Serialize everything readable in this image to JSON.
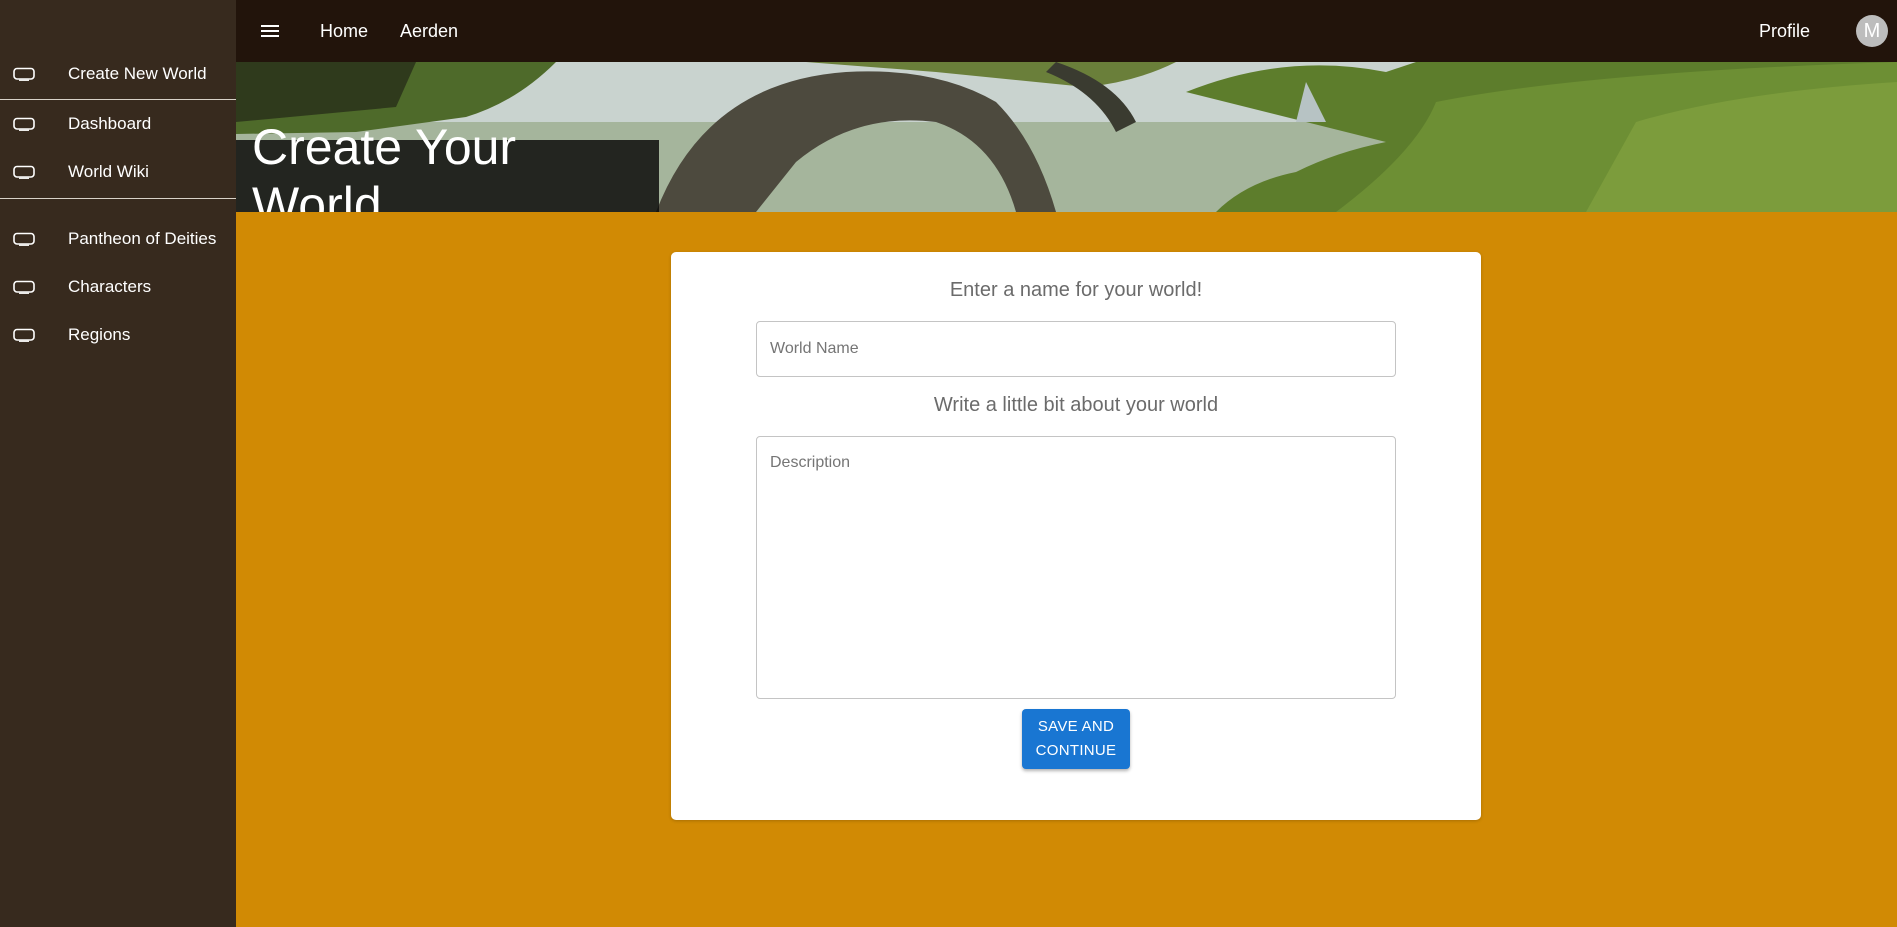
{
  "sidebar": {
    "items": [
      {
        "label": "Create New World",
        "icon": "tv-icon"
      },
      {
        "label": "Dashboard",
        "icon": "tv-icon"
      },
      {
        "label": "World Wiki",
        "icon": "tv-icon"
      },
      {
        "label": "Pantheon of Deities",
        "icon": "tv-icon"
      },
      {
        "label": "Characters",
        "icon": "tv-icon"
      },
      {
        "label": "Regions",
        "icon": "tv-icon"
      }
    ]
  },
  "topbar": {
    "menu_icon": "hamburger-menu-icon",
    "nav": [
      "Home",
      "Aerden"
    ],
    "profile_label": "Profile",
    "avatar_initial": "M"
  },
  "banner": {
    "title": "Create Your World"
  },
  "form": {
    "name_prompt": "Enter a name for your world!",
    "name_placeholder": "World Name",
    "name_value": "",
    "description_prompt": "Write a little bit about your world",
    "description_placeholder": "Description",
    "description_value": "",
    "save_label": "SAVE AND CONTINUE"
  },
  "colors": {
    "sidebar_bg": "#372a1e",
    "topbar_bg": "#22140b",
    "page_bg": "#d18a04",
    "button_bg": "#1976d2"
  }
}
